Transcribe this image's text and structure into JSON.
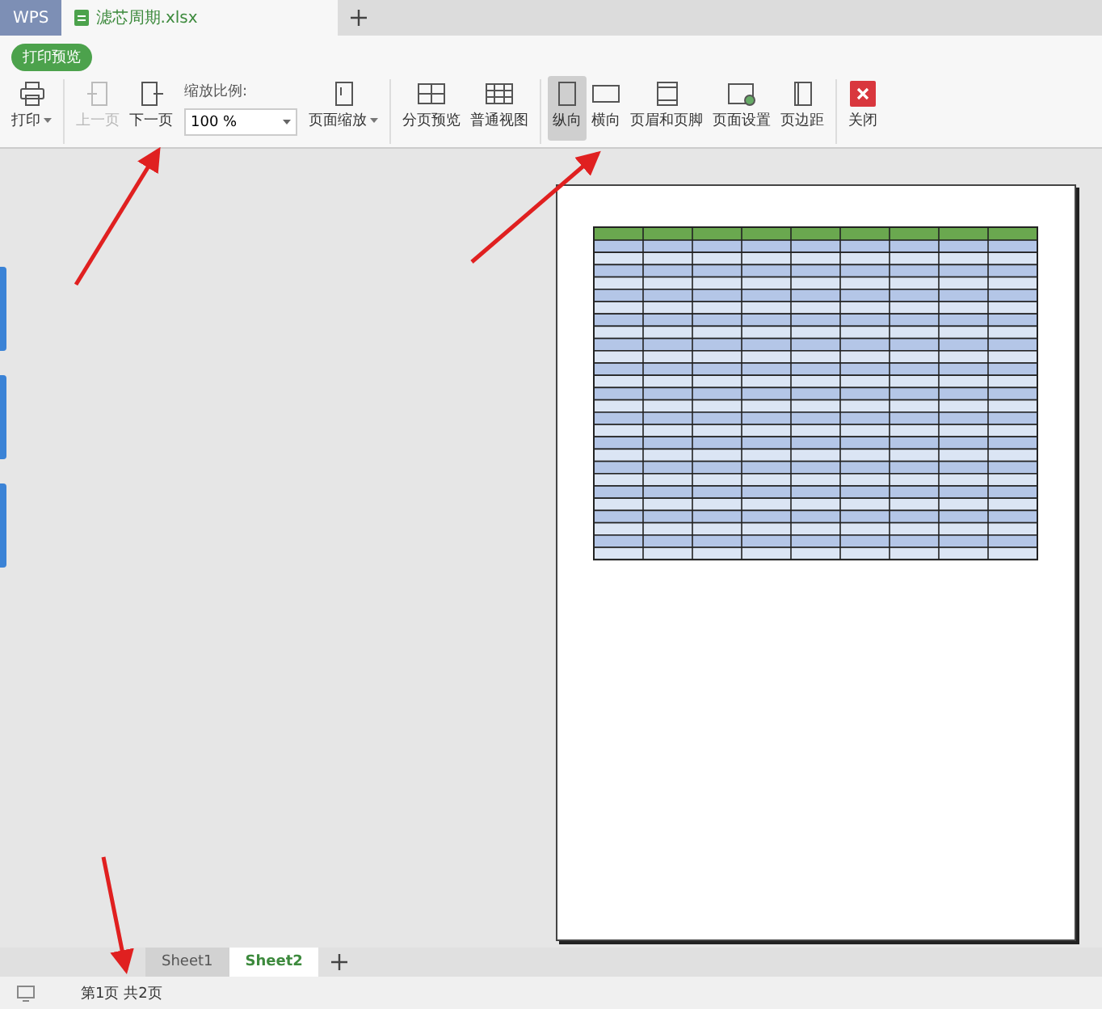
{
  "tabs": [
    {
      "label": "WPS",
      "kind": "home",
      "selected": false
    },
    {
      "label": "滤芯周期.xlsx",
      "kind": "file",
      "selected": true
    }
  ],
  "mode_badge": "打印预览",
  "toolbar": [
    {
      "kind": "print",
      "label": "打印",
      "dropdown": true,
      "disabled": false
    },
    {
      "kind": "separator"
    },
    {
      "kind": "prev",
      "label": "上一页",
      "disabled": true
    },
    {
      "kind": "next",
      "label": "下一页",
      "disabled": false
    },
    {
      "kind": "zoom",
      "label": "缩放比例:",
      "value": "100 %"
    },
    {
      "kind": "fit",
      "label": "页面缩放",
      "dropdown": true,
      "disabled": false
    },
    {
      "kind": "separator"
    },
    {
      "kind": "split",
      "label": "分页预览",
      "disabled": false
    },
    {
      "kind": "normal",
      "label": "普通视图",
      "disabled": false
    },
    {
      "kind": "separator"
    },
    {
      "kind": "portrait",
      "label": "纵向",
      "selected": true
    },
    {
      "kind": "landscape",
      "label": "横向",
      "selected": false
    },
    {
      "kind": "header",
      "label": "页眉和页脚",
      "disabled": false
    },
    {
      "kind": "setup",
      "label": "页面设置",
      "disabled": false
    },
    {
      "kind": "margins",
      "label": "页边距",
      "disabled": false
    },
    {
      "kind": "separator"
    },
    {
      "kind": "close",
      "label": "关闭",
      "disabled": false
    }
  ],
  "sheets": [
    {
      "label": "Sheet1",
      "selected": false
    },
    {
      "label": "Sheet2",
      "selected": true
    }
  ],
  "status_bar": {
    "page_info": "第1页 共2页"
  }
}
